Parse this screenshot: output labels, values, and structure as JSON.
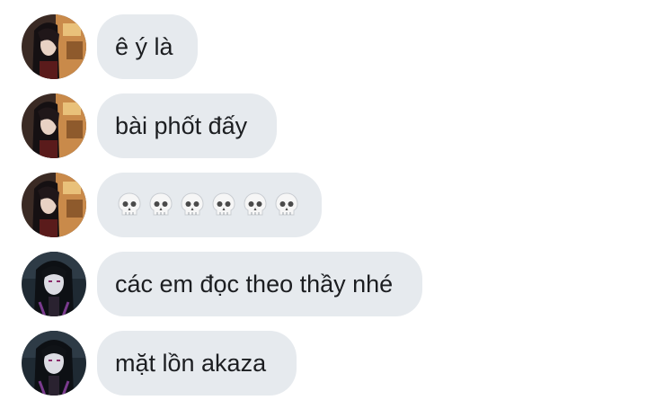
{
  "messages": [
    {
      "sender": "user-a",
      "text": "ê ý là"
    },
    {
      "sender": "user-a",
      "text": "bài phốt đấy"
    },
    {
      "sender": "user-a",
      "emoji": "skull-icon",
      "emoji_count": 6
    },
    {
      "sender": "user-b",
      "text": "các em đọc theo thầy nhé"
    },
    {
      "sender": "user-b",
      "text": "mặt lồn akaza"
    }
  ],
  "colors": {
    "bubble": "#e6eaee",
    "text": "#1c1e21"
  }
}
